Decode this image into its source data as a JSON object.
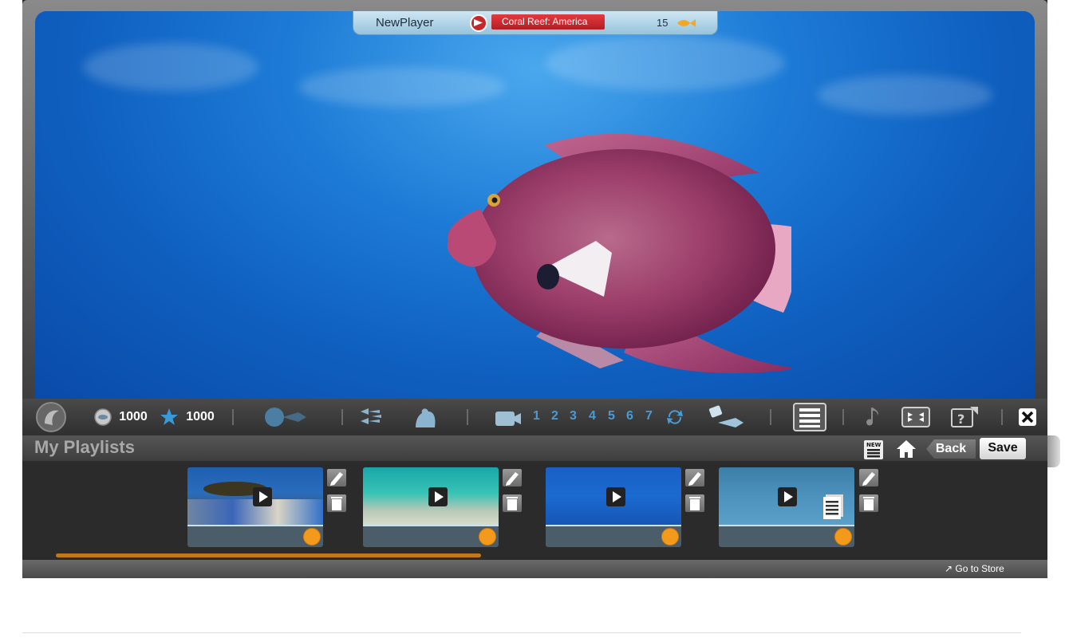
{
  "player_bar": {
    "player_name": "NewPlayer",
    "location": "Coral Reef: America",
    "fish_count": "15",
    "flag_icon": "flag-icon",
    "fish_icon": "gold-fish-icon"
  },
  "toolbar": {
    "coins": "1000",
    "stars": "1000",
    "camera_numbers": [
      "1",
      "2",
      "3",
      "4",
      "5",
      "6",
      "7"
    ],
    "icons": [
      "dolphin-logo-icon",
      "coin-icon",
      "star-icon",
      "shell-fish-icon",
      "fish-school-icon",
      "decorations-icon",
      "camera-icon",
      "loop-icon",
      "fish-feed-icon",
      "playlist-icon",
      "music-note-icon",
      "fullscreen-icon",
      "help-popout-icon",
      "close-icon"
    ]
  },
  "playlists": {
    "title": "My Playlists",
    "back_label": "Back",
    "save_label": "Save",
    "new_icon_text": "NEW",
    "cards": [
      {
        "theme": "coral-reef-thumbnail"
      },
      {
        "theme": "sandy-bottom-thumbnail"
      },
      {
        "theme": "deep-blue-thumbnail"
      },
      {
        "theme": "blue-plants-thumbnail"
      }
    ]
  },
  "footer": {
    "store_label": "Go to Store"
  },
  "colors": {
    "water": "#1d7bd6",
    "toolbar_accent": "#4a9bd4",
    "location_red": "#d6282e",
    "orange_accent": "#f39a1d"
  }
}
